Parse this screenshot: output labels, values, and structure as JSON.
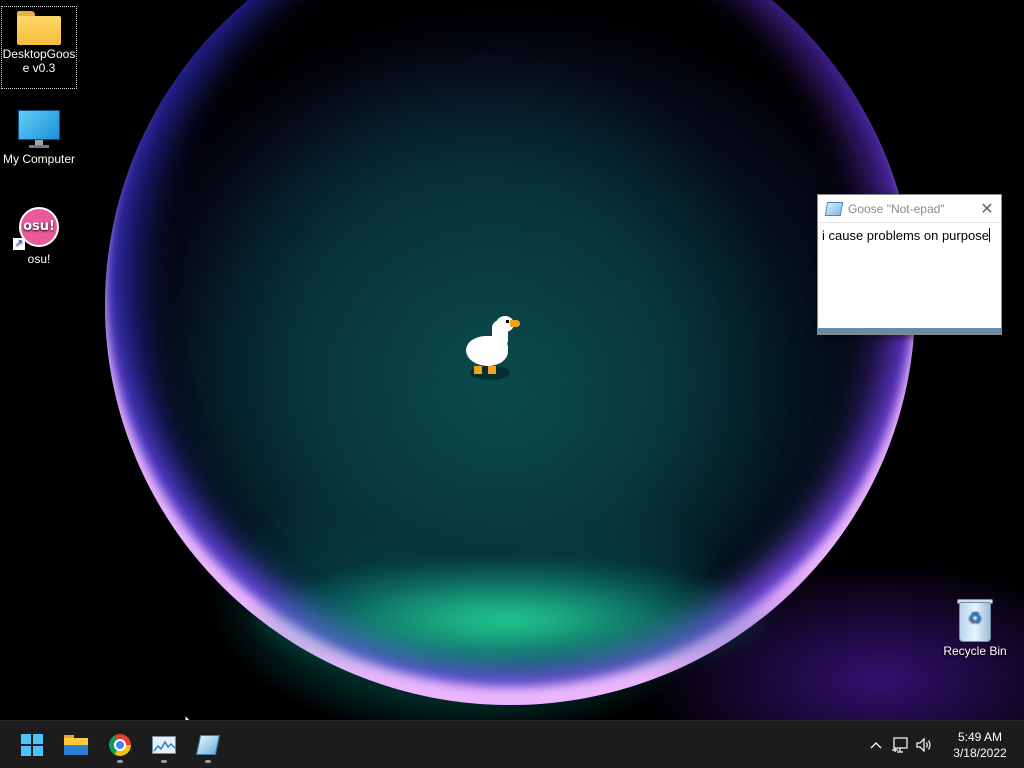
{
  "desktop": {
    "icons": [
      {
        "label": "DesktopGoose v0.3",
        "icon": "folder-icon"
      },
      {
        "label": "My Computer",
        "icon": "monitor-icon"
      },
      {
        "label": "osu!",
        "icon": "osu-icon",
        "glyph_text": "osu!"
      },
      {
        "label": "Recycle Bin",
        "icon": "recycle-bin-icon"
      }
    ]
  },
  "notepad": {
    "title": "Goose \"Not-epad\"",
    "close_glyph": "✕",
    "text": "i cause problems on purpose"
  },
  "taskbar": {
    "apps": [
      {
        "name": "start-button",
        "icon": "windows-logo-icon"
      },
      {
        "name": "file-explorer",
        "icon": "folder-icon"
      },
      {
        "name": "google-chrome",
        "icon": "chrome-icon"
      },
      {
        "name": "task-manager",
        "icon": "task-manager-icon"
      },
      {
        "name": "goose-notepad",
        "icon": "notepad-icon"
      }
    ],
    "tray": {
      "chevron": "^",
      "time": "5:49 AM",
      "date": "3/18/2022"
    }
  },
  "colors": {
    "taskbar_bg": "#1c1c1c",
    "windows_accent": "#4cc2ff",
    "osu_pink": "#ea5a9b"
  }
}
